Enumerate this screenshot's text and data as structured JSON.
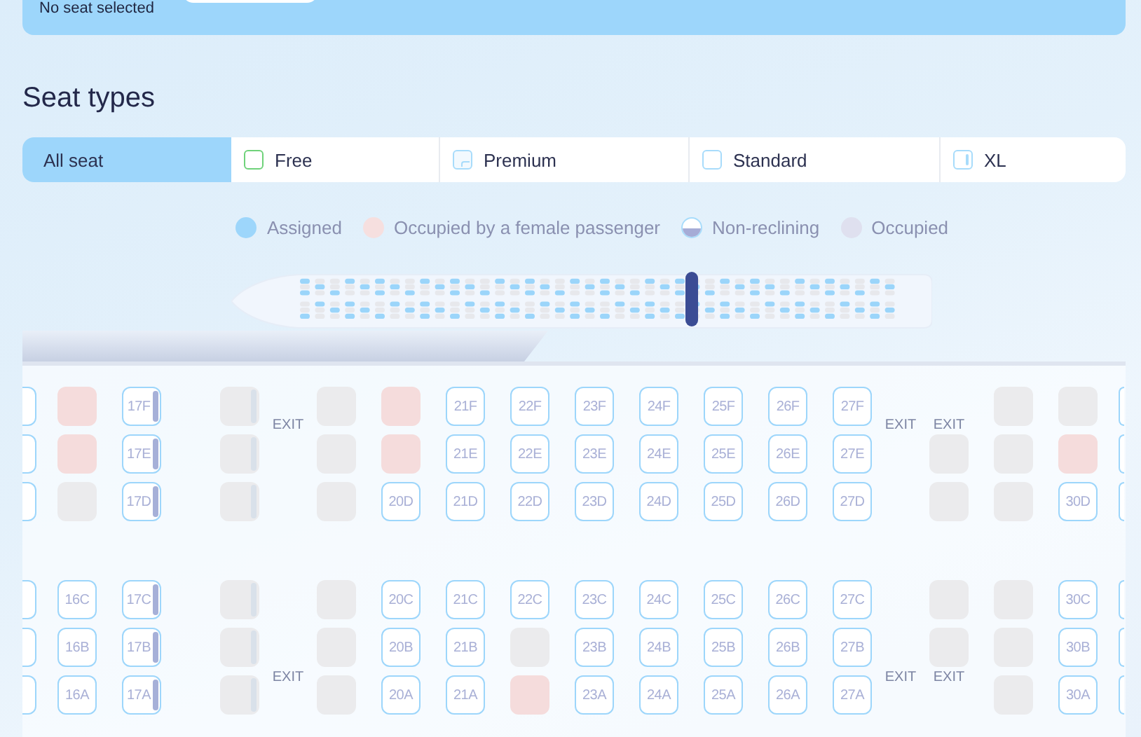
{
  "top_panel": {
    "status": "No seat selected"
  },
  "heading": "Seat types",
  "filters": [
    {
      "label": "All seat",
      "kind": "all",
      "selected": true
    },
    {
      "label": "Free",
      "kind": "free",
      "selected": false
    },
    {
      "label": "Premium",
      "kind": "premium",
      "selected": false
    },
    {
      "label": "Standard",
      "kind": "standard",
      "selected": false
    },
    {
      "label": "XL",
      "kind": "xl",
      "selected": false
    }
  ],
  "legend": [
    {
      "label": "Assigned",
      "kind": "dot",
      "color": "#9dd6fb"
    },
    {
      "label": "Occupied by a female passenger",
      "kind": "dot",
      "color": "#f6dfdf"
    },
    {
      "label": "Non-reclining",
      "kind": "half"
    },
    {
      "label": "Occupied",
      "kind": "dot",
      "color": "#dfe0ef"
    }
  ],
  "seat_map": {
    "columns": [
      {
        "kind": "cut",
        "seats": [
          {
            "kind": "free"
          },
          {
            "kind": "free"
          },
          {
            "kind": "free"
          },
          {
            "kind": "free"
          },
          {
            "kind": "free"
          },
          {
            "kind": "free"
          }
        ]
      },
      {
        "kind": "seats",
        "seats": [
          {
            "kind": "female"
          },
          {
            "kind": "female"
          },
          {
            "kind": "occupied"
          },
          {
            "kind": "free",
            "label": "16C"
          },
          {
            "kind": "free",
            "label": "16B"
          },
          {
            "kind": "free",
            "label": "16A"
          }
        ]
      },
      {
        "kind": "seats",
        "seats": [
          {
            "kind": "xl",
            "label": "17F"
          },
          {
            "kind": "xl",
            "label": "17E"
          },
          {
            "kind": "xl",
            "label": "17D"
          },
          {
            "kind": "xl",
            "label": "17C"
          },
          {
            "kind": "xl",
            "label": "17B"
          },
          {
            "kind": "xl",
            "label": "17A"
          }
        ]
      },
      {
        "kind": "seats",
        "seats": [
          {
            "kind": "occupied-xl"
          },
          {
            "kind": "occupied-xl"
          },
          {
            "kind": "occupied-xl"
          },
          {
            "kind": "occupied-xl"
          },
          {
            "kind": "occupied-xl"
          },
          {
            "kind": "occupied-xl"
          }
        ]
      },
      {
        "kind": "exit",
        "seats": [
          {
            "kind": "exit",
            "label": "EXIT"
          },
          {
            "kind": "blank"
          },
          {
            "kind": "blank"
          },
          {
            "kind": "blank"
          },
          {
            "kind": "blank"
          },
          {
            "kind": "exit",
            "label": "EXIT"
          }
        ]
      },
      {
        "kind": "seats",
        "seats": [
          {
            "kind": "occupied"
          },
          {
            "kind": "occupied"
          },
          {
            "kind": "occupied"
          },
          {
            "kind": "occupied"
          },
          {
            "kind": "occupied"
          },
          {
            "kind": "occupied"
          }
        ]
      },
      {
        "kind": "seats",
        "seats": [
          {
            "kind": "female"
          },
          {
            "kind": "female"
          },
          {
            "kind": "free",
            "label": "20D"
          },
          {
            "kind": "free",
            "label": "20C"
          },
          {
            "kind": "free",
            "label": "20B"
          },
          {
            "kind": "free",
            "label": "20A"
          }
        ]
      },
      {
        "kind": "seats",
        "seats": [
          {
            "kind": "free",
            "label": "21F"
          },
          {
            "kind": "free",
            "label": "21E"
          },
          {
            "kind": "free",
            "label": "21D"
          },
          {
            "kind": "free",
            "label": "21C"
          },
          {
            "kind": "free",
            "label": "21B"
          },
          {
            "kind": "free",
            "label": "21A"
          }
        ]
      },
      {
        "kind": "seats",
        "seats": [
          {
            "kind": "free",
            "label": "22F"
          },
          {
            "kind": "free",
            "label": "22E"
          },
          {
            "kind": "free",
            "label": "22D"
          },
          {
            "kind": "free",
            "label": "22C"
          },
          {
            "kind": "occupied"
          },
          {
            "kind": "female"
          }
        ]
      },
      {
        "kind": "seats",
        "seats": [
          {
            "kind": "free",
            "label": "23F"
          },
          {
            "kind": "free",
            "label": "23E"
          },
          {
            "kind": "free",
            "label": "23D"
          },
          {
            "kind": "free",
            "label": "23C"
          },
          {
            "kind": "free",
            "label": "23B"
          },
          {
            "kind": "free",
            "label": "23A"
          }
        ]
      },
      {
        "kind": "seats",
        "seats": [
          {
            "kind": "free",
            "label": "24F"
          },
          {
            "kind": "free",
            "label": "24E"
          },
          {
            "kind": "free",
            "label": "24D"
          },
          {
            "kind": "free",
            "label": "24C"
          },
          {
            "kind": "free",
            "label": "24B"
          },
          {
            "kind": "free",
            "label": "24A"
          }
        ]
      },
      {
        "kind": "seats",
        "seats": [
          {
            "kind": "free",
            "label": "25F"
          },
          {
            "kind": "free",
            "label": "25E"
          },
          {
            "kind": "free",
            "label": "25D"
          },
          {
            "kind": "free",
            "label": "25C"
          },
          {
            "kind": "free",
            "label": "25B"
          },
          {
            "kind": "free",
            "label": "25A"
          }
        ]
      },
      {
        "kind": "seats",
        "seats": [
          {
            "kind": "free",
            "label": "26F"
          },
          {
            "kind": "free",
            "label": "26E"
          },
          {
            "kind": "free",
            "label": "26D"
          },
          {
            "kind": "free",
            "label": "26C"
          },
          {
            "kind": "free",
            "label": "26B"
          },
          {
            "kind": "free",
            "label": "26A"
          }
        ]
      },
      {
        "kind": "seats",
        "seats": [
          {
            "kind": "free",
            "label": "27F"
          },
          {
            "kind": "free",
            "label": "27E"
          },
          {
            "kind": "free",
            "label": "27D"
          },
          {
            "kind": "free",
            "label": "27C"
          },
          {
            "kind": "free",
            "label": "27B"
          },
          {
            "kind": "free",
            "label": "27A"
          }
        ]
      },
      {
        "kind": "exit",
        "seats": [
          {
            "kind": "exit",
            "label": "EXIT"
          },
          {
            "kind": "blank"
          },
          {
            "kind": "blank"
          },
          {
            "kind": "blank"
          },
          {
            "kind": "blank"
          },
          {
            "kind": "exit",
            "label": "EXIT"
          }
        ]
      },
      {
        "kind": "seats",
        "seats": [
          {
            "kind": "exit",
            "label": "EXIT"
          },
          {
            "kind": "occupied"
          },
          {
            "kind": "occupied"
          },
          {
            "kind": "occupied"
          },
          {
            "kind": "occupied"
          },
          {
            "kind": "exit",
            "label": "EXIT"
          }
        ]
      },
      {
        "kind": "seats",
        "seats": [
          {
            "kind": "occupied"
          },
          {
            "kind": "occupied"
          },
          {
            "kind": "occupied"
          },
          {
            "kind": "occupied"
          },
          {
            "kind": "occupied"
          },
          {
            "kind": "occupied"
          }
        ]
      },
      {
        "kind": "seats",
        "seats": [
          {
            "kind": "occupied"
          },
          {
            "kind": "female"
          },
          {
            "kind": "free",
            "label": "30D"
          },
          {
            "kind": "free",
            "label": "30C"
          },
          {
            "kind": "free",
            "label": "30B"
          },
          {
            "kind": "free",
            "label": "30A"
          }
        ]
      },
      {
        "kind": "cut-right",
        "seats": [
          {
            "kind": "free"
          },
          {
            "kind": "free"
          },
          {
            "kind": "free"
          },
          {
            "kind": "free"
          },
          {
            "kind": "free"
          },
          {
            "kind": "free"
          }
        ]
      }
    ]
  }
}
